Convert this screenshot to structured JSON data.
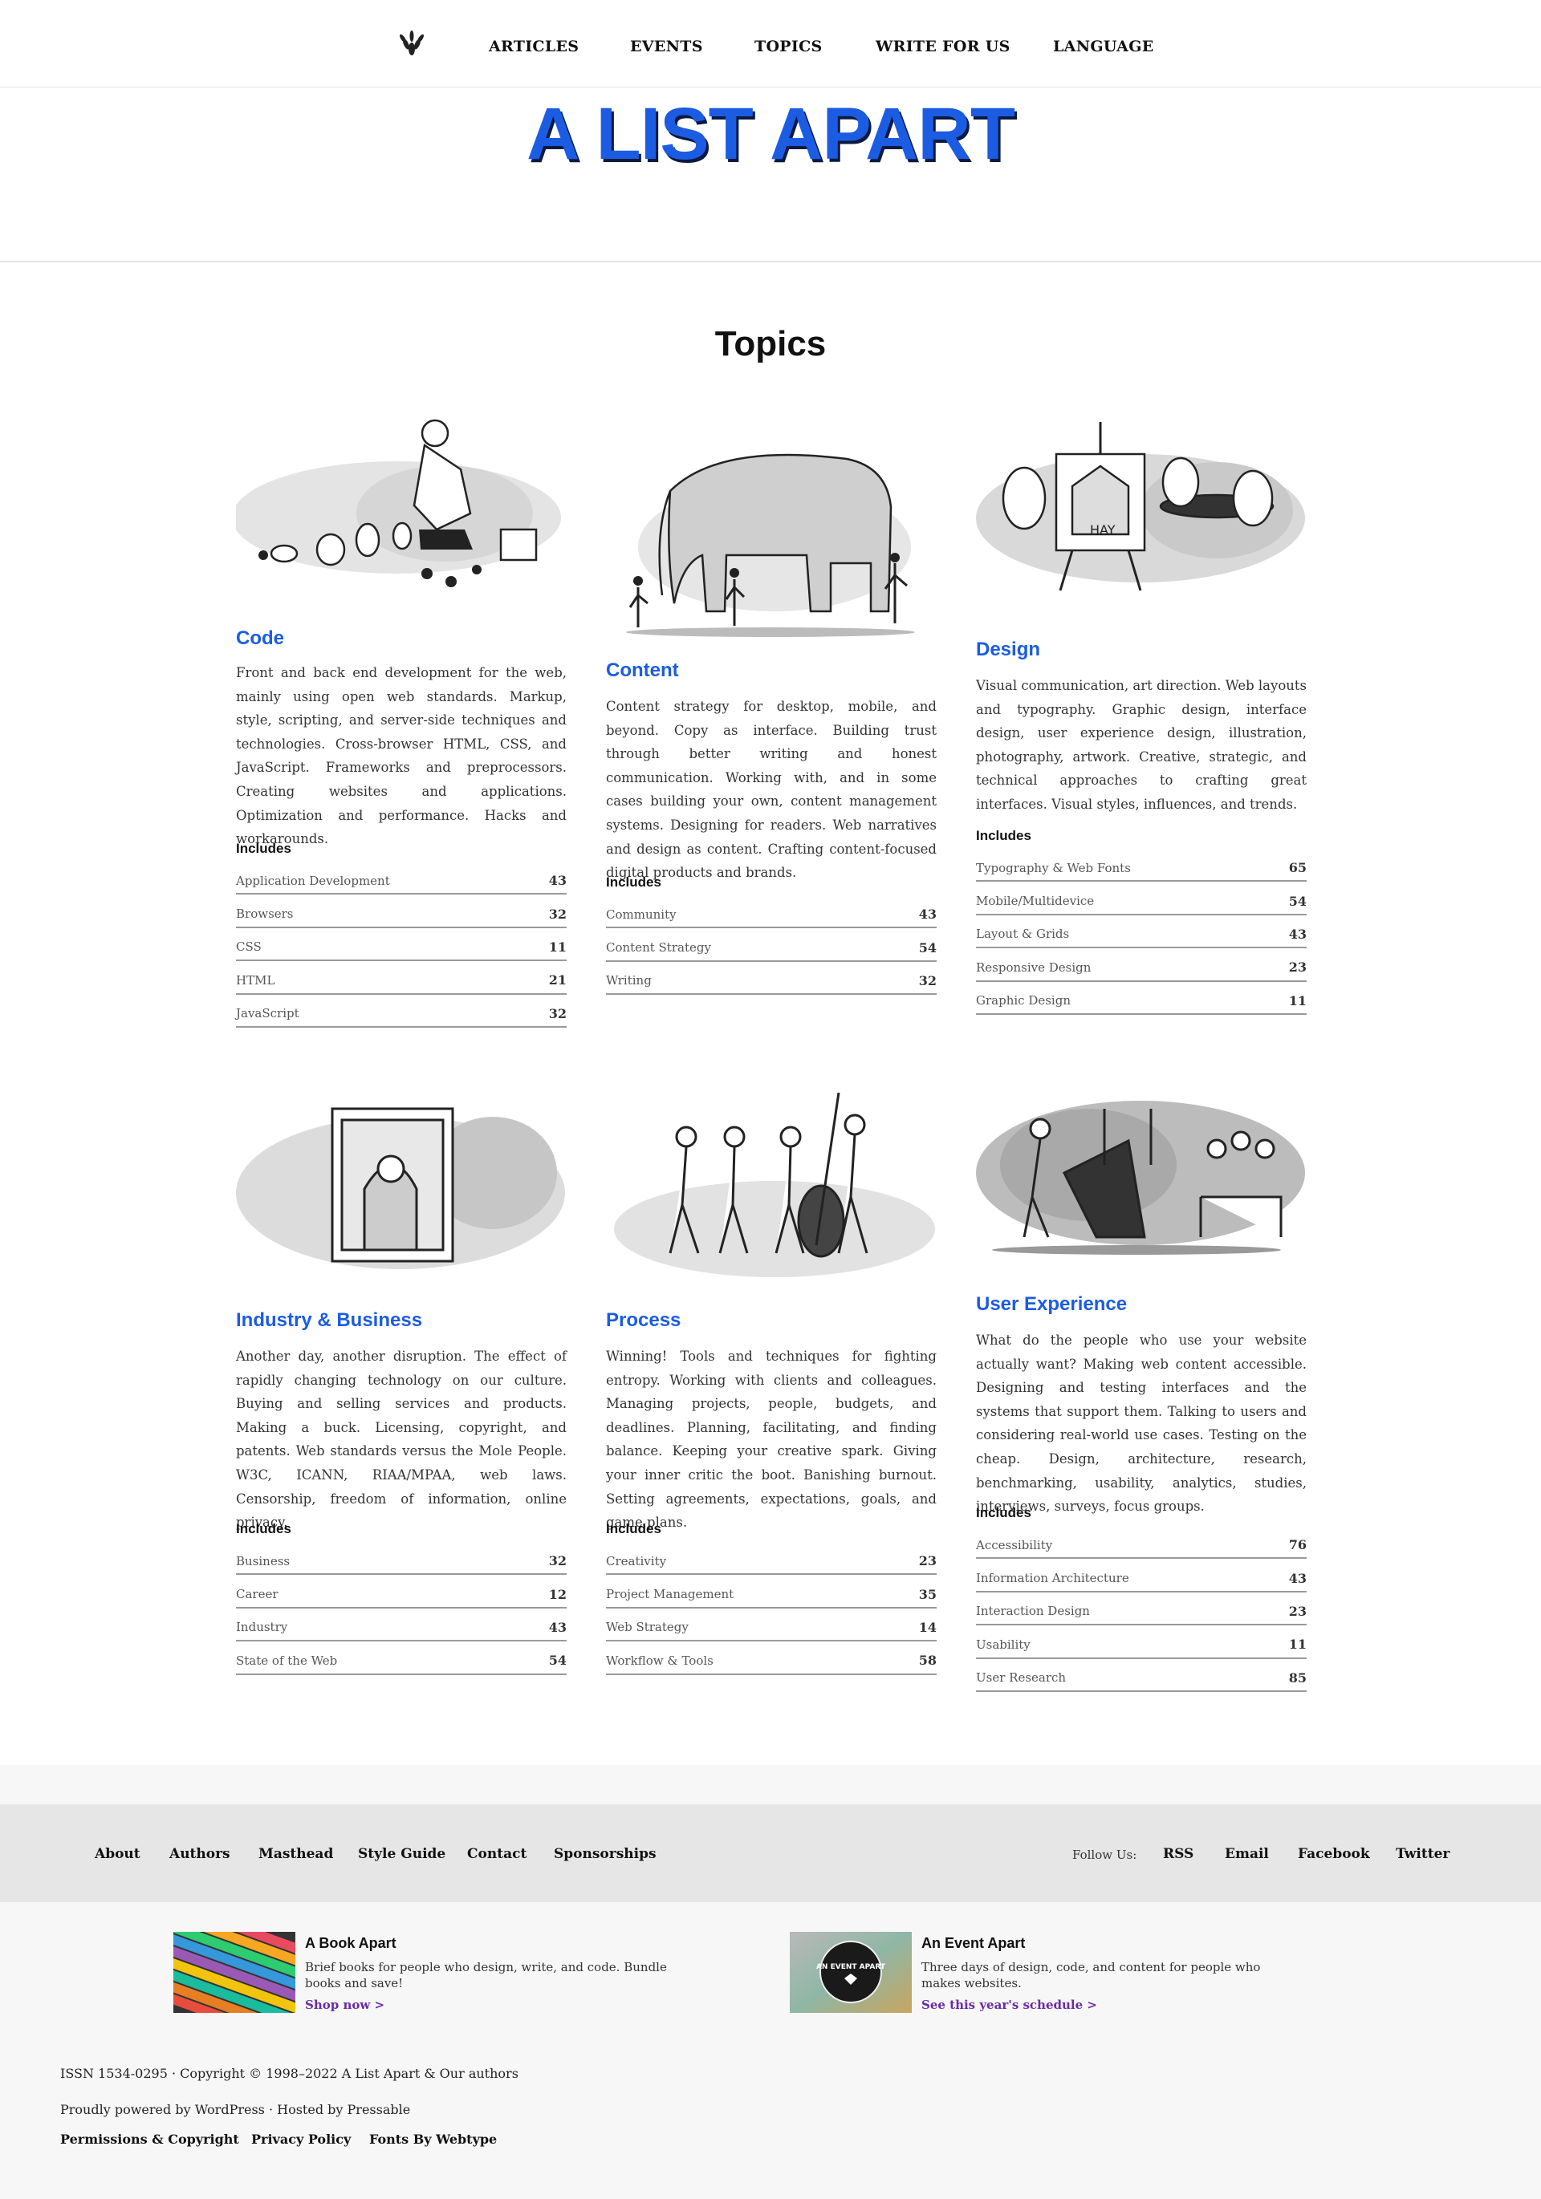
{
  "nav": {
    "items": [
      "ARTICLES",
      "EVENTS",
      "TOPICS",
      "WRITE FOR US",
      "LANGUAGE"
    ]
  },
  "brand": {
    "name": "A LIST APART",
    "color": "#1b5ce3"
  },
  "page": {
    "title": "Topics"
  },
  "topics": [
    {
      "title": "Code",
      "description": "Front and back end development for the web, mainly using open web standards. Markup, style, scripting, and server-side techniques and technologies. Cross-browser HTML, CSS, and JavaScript. Frameworks and preprocessors. Creating websites and applications. Optimization and performance. Hacks and workarounds.",
      "includes_label": "Includes",
      "items": [
        {
          "label": "Application Development",
          "count": "43"
        },
        {
          "label": "Browsers",
          "count": "32"
        },
        {
          "label": "CSS",
          "count": "11"
        },
        {
          "label": "HTML",
          "count": "21"
        },
        {
          "label": "JavaScript",
          "count": "32"
        }
      ]
    },
    {
      "title": "Content",
      "description": "Content strategy for desktop, mobile, and beyond. Copy as interface. Building trust through better writing and honest communication. Working with, and in some cases building your own, content management systems. Designing for readers. Web narratives and design as content. Crafting content-focused digital products and brands.",
      "includes_label": "Includes",
      "items": [
        {
          "label": "Community",
          "count": "43"
        },
        {
          "label": "Content Strategy",
          "count": "54"
        },
        {
          "label": "Writing",
          "count": "32"
        }
      ]
    },
    {
      "title": "Design",
      "description": "Visual communication, art direction. Web layouts and typography. Graphic design, interface design, user experience design, illustration, photography, artwork. Creative, strategic, and technical approaches to crafting great interfaces. Visual styles, influences, and trends.",
      "includes_label": "Includes",
      "items": [
        {
          "label": "Typography & Web Fonts",
          "count": "65"
        },
        {
          "label": "Mobile/Multidevice",
          "count": "54"
        },
        {
          "label": "Layout & Grids",
          "count": "43"
        },
        {
          "label": "Responsive Design",
          "count": "23"
        },
        {
          "label": "Graphic Design",
          "count": "11"
        }
      ]
    },
    {
      "title": "Industry & Business",
      "description": "Another day, another disruption. The effect of rapidly changing technology on our culture. Buying and selling services and products. Making a buck. Licensing, copyright, and patents. Web standards versus the Mole People. W3C, ICANN, RIAA/MPAA, web laws. Censorship, freedom of information, online privacy.",
      "includes_label": "Includes",
      "items": [
        {
          "label": "Business",
          "count": "32"
        },
        {
          "label": "Career",
          "count": "12"
        },
        {
          "label": "Industry",
          "count": "43"
        },
        {
          "label": "State of the Web",
          "count": "54"
        }
      ]
    },
    {
      "title": "Process",
      "description": "Winning! Tools and techniques for fighting entropy. Working with clients and colleagues. Managing projects, people, budgets, and deadlines. Planning, facilitating, and finding balance. Keeping your creative spark. Giving your inner critic the boot. Banishing burnout. Setting agreements, expectations, goals, and game plans.",
      "includes_label": "Includes",
      "items": [
        {
          "label": "Creativity",
          "count": "23"
        },
        {
          "label": "Project Management",
          "count": "35"
        },
        {
          "label": "Web Strategy",
          "count": "14"
        },
        {
          "label": "Workflow & Tools",
          "count": "58"
        }
      ]
    },
    {
      "title": "User Experience",
      "description": "What do the people who use your website actually want? Making web content accessible. Designing and testing interfaces and the systems that support them. Talking to users and considering real-world use cases. Testing on the cheap. Design, architecture, research, benchmarking, usability, analytics, studies, interviews, surveys, focus groups.",
      "includes_label": "Includes",
      "items": [
        {
          "label": "Accessibility",
          "count": "76"
        },
        {
          "label": "Information Architecture",
          "count": "43"
        },
        {
          "label": "Interaction Design",
          "count": "23"
        },
        {
          "label": "Usability",
          "count": "11"
        },
        {
          "label": "User Research",
          "count": "85"
        }
      ]
    }
  ],
  "footer": {
    "links": [
      "About",
      "Authors",
      "Masthead",
      "Style Guide",
      "Contact",
      "Sponsorships"
    ],
    "follow_label": "Follow Us:",
    "social": [
      "RSS",
      "Email",
      "Facebook",
      "Twitter"
    ],
    "promos": [
      {
        "title": "A Book Apart",
        "text": "Brief books for people who design, write, and code. Bundle books and save!",
        "link": "Shop now >"
      },
      {
        "title": "An Event Apart",
        "text": "Three days of design, code, and content for people who makes websites.",
        "link": "See this year's schedule >",
        "badge": "AN EVENT APART"
      }
    ],
    "copyright": "ISSN 1534-0295 · Copyright © 1998–2022 A List Apart & Our authors",
    "powered": "Proudly powered by WordPress · Hosted by Pressable",
    "legal_links": [
      "Permissions & Copyright",
      "Privacy Policy",
      "Fonts By Webtype"
    ]
  }
}
